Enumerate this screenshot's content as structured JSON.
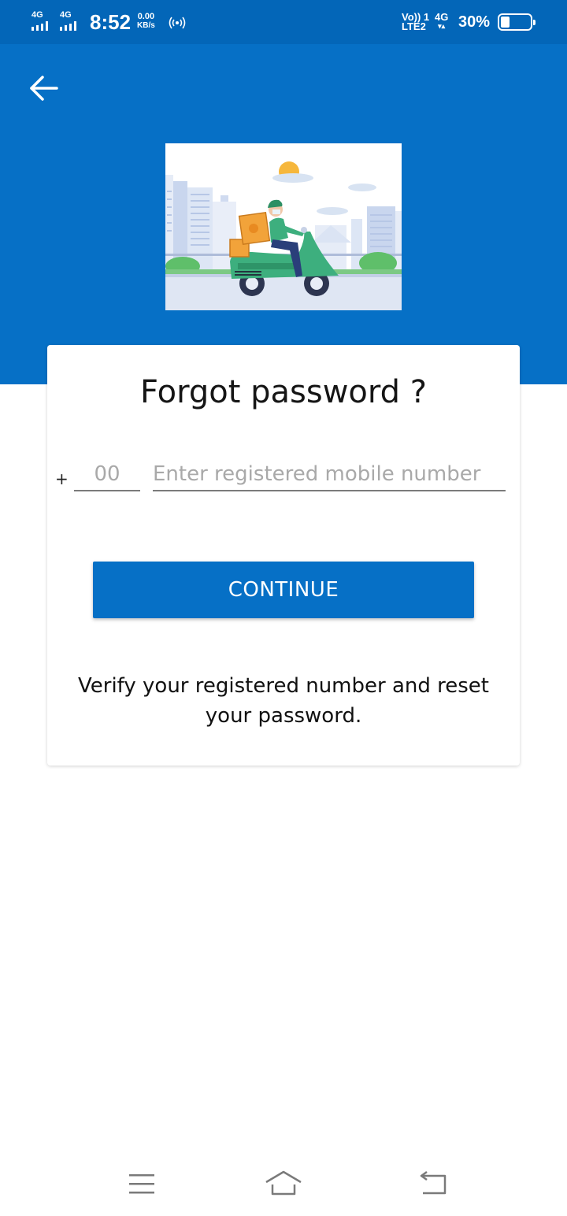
{
  "status_bar": {
    "sim1_network": "4G",
    "sim2_network": "4G",
    "time": "8:52",
    "speed_value": "0.00",
    "speed_unit": "KB/s",
    "volte_line1": "Vo)) 1",
    "volte_line2": "LTE2",
    "data_network": "4G",
    "battery_percent": "30%",
    "battery_level": 0.3
  },
  "header": {
    "back_icon": "arrow-left-icon",
    "background_color": "#0670c6"
  },
  "card": {
    "title": "Forgot password ?",
    "plus_sign": "+",
    "country_code_placeholder": "00",
    "phone_placeholder": "Enter registered mobile number",
    "continue_label": "CONTINUE",
    "info_text": "Verify your registered number and reset your password."
  },
  "nav_bar": {
    "menu_icon": "menu-icon",
    "home_icon": "home-icon",
    "back_icon": "back-icon"
  },
  "colors": {
    "primary": "#0670c6",
    "status_bar": "#0366b8"
  }
}
